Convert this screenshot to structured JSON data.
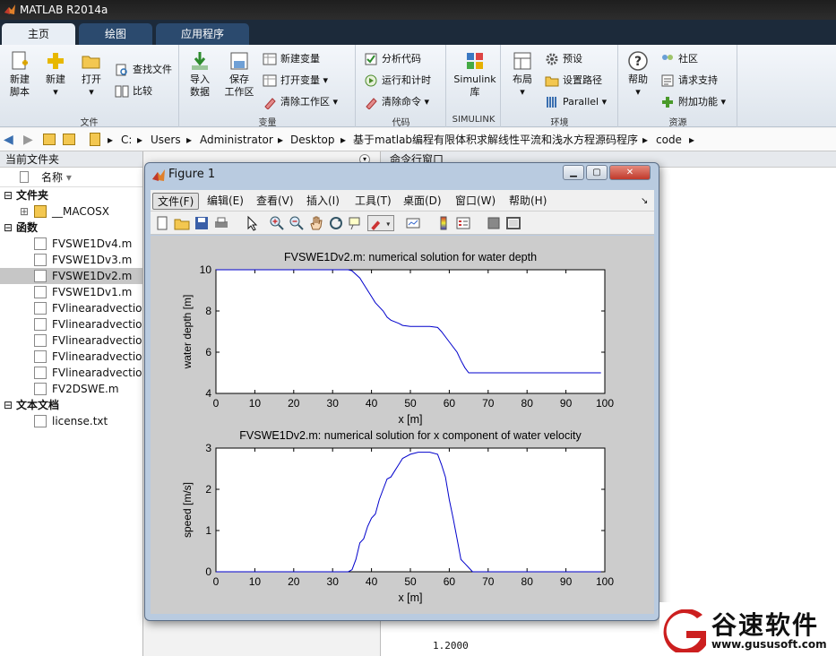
{
  "app": {
    "title": "MATLAB R2014a"
  },
  "tabs": [
    {
      "label": "主页"
    },
    {
      "label": "绘图"
    },
    {
      "label": "应用程序"
    }
  ],
  "ribbon": {
    "file": {
      "label": "文件",
      "new_script": "新建\n脚本",
      "new": "新建",
      "open": "打开",
      "find_files": "查找文件",
      "compare": "比较"
    },
    "variable": {
      "label": "变量",
      "import": "导入\n数据",
      "save_ws": "保存\n工作区",
      "new_var": "新建变量",
      "open_var": "打开变量",
      "clear_ws": "清除工作区"
    },
    "code": {
      "label": "代码",
      "analyze": "分析代码",
      "run_time": "运行和计时",
      "clear_cmd": "清除命令"
    },
    "simulink": {
      "label": "SIMULINK",
      "lib": "Simulink\n库"
    },
    "env": {
      "label": "环境",
      "layout": "布局",
      "prefs": "预设",
      "set_path": "设置路径",
      "parallel": "Parallel"
    },
    "resources": {
      "label": "资源",
      "help": "帮助",
      "community": "社区",
      "support": "请求支持",
      "addons": "附加功能"
    }
  },
  "address": {
    "segments": [
      "C:",
      "Users",
      "Administrator",
      "Desktop",
      "基于matlab编程有限体积求解线性平流和浅水方程源码程序",
      "code"
    ]
  },
  "current_folder": {
    "title": "当前文件夹",
    "name_col": "名称",
    "sections": [
      {
        "label": "文件夹",
        "items": [
          {
            "name": "__MACOSX",
            "selected": false
          }
        ]
      },
      {
        "label": "函数",
        "items": [
          {
            "name": "FVSWE1Dv4.m",
            "selected": false
          },
          {
            "name": "FVSWE1Dv3.m",
            "selected": false
          },
          {
            "name": "FVSWE1Dv2.m",
            "selected": true
          },
          {
            "name": "FVSWE1Dv1.m",
            "selected": false
          },
          {
            "name": "FVlinearadvection",
            "selected": false
          },
          {
            "name": "FVlinearadvection",
            "selected": false
          },
          {
            "name": "FVlinearadvection",
            "selected": false
          },
          {
            "name": "FVlinearadvection",
            "selected": false
          },
          {
            "name": "FVlinearadvection",
            "selected": false
          },
          {
            "name": "FV2DSWE.m",
            "selected": false
          }
        ]
      },
      {
        "label": "文本文档",
        "items": [
          {
            "name": "license.txt",
            "selected": false
          }
        ]
      }
    ]
  },
  "command_window": {
    "title": "命令行窗口",
    "value": "1.2000"
  },
  "figure": {
    "title": "Figure 1",
    "menu": [
      "文件(F)",
      "编辑(E)",
      "查看(V)",
      "插入(I)",
      "工具(T)",
      "桌面(D)",
      "窗口(W)",
      "帮助(H)"
    ]
  },
  "watermark": {
    "brand": "谷速软件",
    "url": "www.gususoft.com"
  },
  "colors": {
    "line": "#0000cc",
    "accent": "#2b4a6e",
    "watermark_red": "#cc1f1f"
  },
  "chart_data": [
    {
      "type": "line",
      "title": "FVSWE1Dv2.m: numerical solution for water depth",
      "xlabel": "x [m]",
      "ylabel": "water depth [m]",
      "xlim": [
        0,
        100
      ],
      "ylim": [
        4,
        10
      ],
      "xticks": [
        0,
        10,
        20,
        30,
        40,
        50,
        60,
        70,
        80,
        90,
        100
      ],
      "yticks": [
        4,
        6,
        8,
        10
      ],
      "grid": false,
      "x": [
        0,
        34,
        35,
        37,
        38,
        40,
        41,
        43,
        44,
        45,
        47,
        48,
        50,
        55,
        57,
        58,
        60,
        62,
        63,
        64,
        65,
        99
      ],
      "y": [
        10,
        10,
        9.95,
        9.6,
        9.3,
        8.7,
        8.4,
        8.0,
        7.7,
        7.55,
        7.4,
        7.3,
        7.25,
        7.25,
        7.2,
        7.0,
        6.5,
        6.0,
        5.6,
        5.25,
        5.0,
        5.0
      ]
    },
    {
      "type": "line",
      "title": "FVSWE1Dv2.m: numerical solution for x component of water velocity",
      "xlabel": "x [m]",
      "ylabel": "speed [m/s]",
      "xlim": [
        0,
        100
      ],
      "ylim": [
        0,
        3
      ],
      "xticks": [
        0,
        10,
        20,
        30,
        40,
        50,
        60,
        70,
        80,
        90,
        100
      ],
      "yticks": [
        0,
        1,
        2,
        3
      ],
      "grid": false,
      "x": [
        0,
        34,
        35,
        36,
        37,
        38,
        39,
        40,
        41,
        42,
        43,
        44,
        45,
        46,
        47,
        48,
        50,
        52,
        55,
        57,
        58,
        59,
        60,
        61,
        62,
        63,
        64,
        65,
        66,
        99
      ],
      "y": [
        0,
        0,
        0.05,
        0.3,
        0.7,
        0.8,
        1.1,
        1.3,
        1.4,
        1.75,
        2.0,
        2.25,
        2.3,
        2.45,
        2.6,
        2.75,
        2.85,
        2.9,
        2.9,
        2.85,
        2.6,
        2.3,
        1.75,
        1.3,
        0.8,
        0.3,
        0.2,
        0.1,
        0,
        0
      ]
    }
  ]
}
